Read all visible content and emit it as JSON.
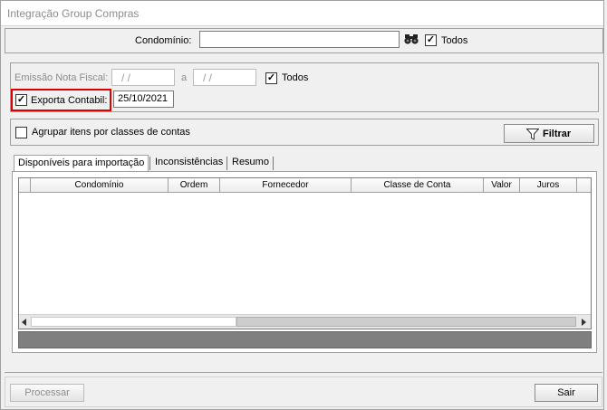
{
  "window": {
    "title": "Integração Group Compras"
  },
  "condominio": {
    "label": "Condomínio:",
    "value": "",
    "todos_label": "Todos",
    "todos_checked": true
  },
  "emissao": {
    "label": "Emissão Nota Fiscal:",
    "start_value": "/ /",
    "separator": "a",
    "end_value": "/ /",
    "todos_label": "Todos",
    "todos_checked": true
  },
  "exporta": {
    "label": "Exporta Contabil:",
    "checked": true,
    "date": "25/10/2021"
  },
  "agrupar": {
    "label": "Agrupar itens por classes de contas",
    "checked": false
  },
  "filtrar": {
    "label": "Filtrar"
  },
  "tabs": [
    {
      "label": "Disponíveis para importação",
      "active": true
    },
    {
      "label": "Inconsistências",
      "active": false
    },
    {
      "label": "Resumo",
      "active": false
    }
  ],
  "grid": {
    "columns": [
      "Condomínio",
      "Ordem",
      "Fornecedor",
      "Classe de Conta",
      "Valor",
      "Juros"
    ]
  },
  "footer": {
    "processar_label": "Processar",
    "sair_label": "Sair"
  },
  "colors": {
    "highlight": "#e00000",
    "grid_footer": "#7f7f7f"
  },
  "icons": {
    "search": "binoculars-icon",
    "filter": "funnel-icon"
  }
}
